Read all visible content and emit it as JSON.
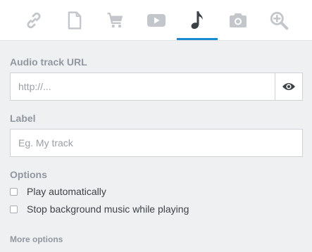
{
  "tabs": [
    {
      "icon": "link-icon"
    },
    {
      "icon": "document-icon"
    },
    {
      "icon": "cart-icon"
    },
    {
      "icon": "video-icon"
    },
    {
      "icon": "music-note-icon",
      "active": true
    },
    {
      "icon": "camera-icon"
    },
    {
      "icon": "zoom-in-icon"
    }
  ],
  "colors": {
    "accent": "#1a8ad1",
    "icon_inactive": "#c3c7cc",
    "icon_active": "#3c4146",
    "label": "#9097a0",
    "background": "#eff0f2"
  },
  "audio_url": {
    "label": "Audio track URL",
    "value": "",
    "placeholder": "http://...",
    "preview_icon": "eye-icon"
  },
  "track_label": {
    "label": "Label",
    "value": "",
    "placeholder": "Eg. My track"
  },
  "options": {
    "heading": "Options",
    "items": [
      {
        "label": "Play automatically",
        "checked": false
      },
      {
        "label": "Stop background music while playing",
        "checked": false
      }
    ]
  },
  "more_options": "More options"
}
